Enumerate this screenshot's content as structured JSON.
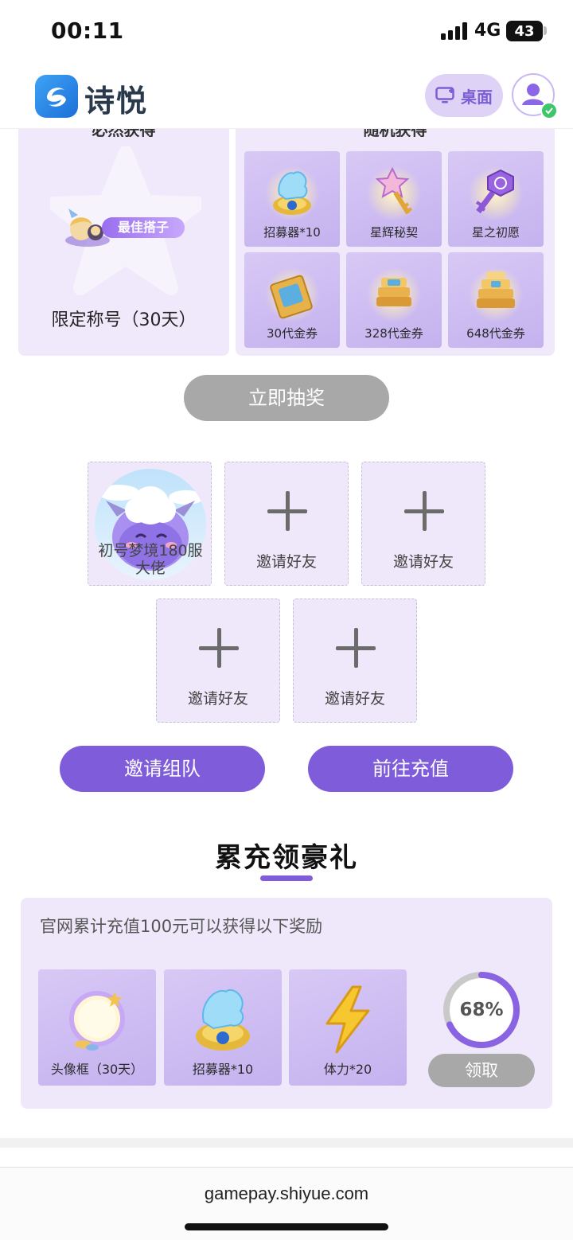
{
  "status_bar": {
    "time": "00:11",
    "network": "4G",
    "battery": "43"
  },
  "header": {
    "brand": "诗悦",
    "desktop_label": "桌面"
  },
  "rewards": {
    "guaranteed_title": "必然获得",
    "random_title": "随机获得",
    "guaranteed": {
      "badge_text": "最佳搭子",
      "label": "限定称号（30天）"
    },
    "random_items": [
      {
        "label": "招募器*10",
        "icon": "recruiter-icon"
      },
      {
        "label": "星辉秘契",
        "icon": "star-key-icon"
      },
      {
        "label": "星之初愿",
        "icon": "purple-key-icon"
      },
      {
        "label": "30代金券",
        "icon": "voucher-icon"
      },
      {
        "label": "328代金券",
        "icon": "voucher-stack-icon"
      },
      {
        "label": "648代金券",
        "icon": "voucher-stack-icon"
      }
    ],
    "draw_button": "立即抽奖"
  },
  "team": {
    "leader_name": "初号梦境180服大佬",
    "invite_label": "邀请好友",
    "slots": [
      "邀请好友",
      "邀请好友",
      "邀请好友",
      "邀请好友"
    ]
  },
  "actions": {
    "invite_team": "邀请组队",
    "go_recharge": "前往充值"
  },
  "cumulative": {
    "title": "累充领豪礼",
    "description": "官网累计充值100元可以获得以下奖励",
    "items": [
      {
        "label": "头像框（30天）",
        "icon": "avatar-frame-icon"
      },
      {
        "label": "招募器*10",
        "icon": "recruiter-icon"
      },
      {
        "label": "体力*20",
        "icon": "lightning-icon"
      }
    ],
    "progress_text": "68%",
    "progress_value": 0.68,
    "claim_button": "领取"
  },
  "browser": {
    "url": "gamepay.shiyue.com"
  },
  "colors": {
    "accent": "#7f5cd9",
    "panel": "#f0e9fb",
    "disabled": "#a8a8a8"
  }
}
